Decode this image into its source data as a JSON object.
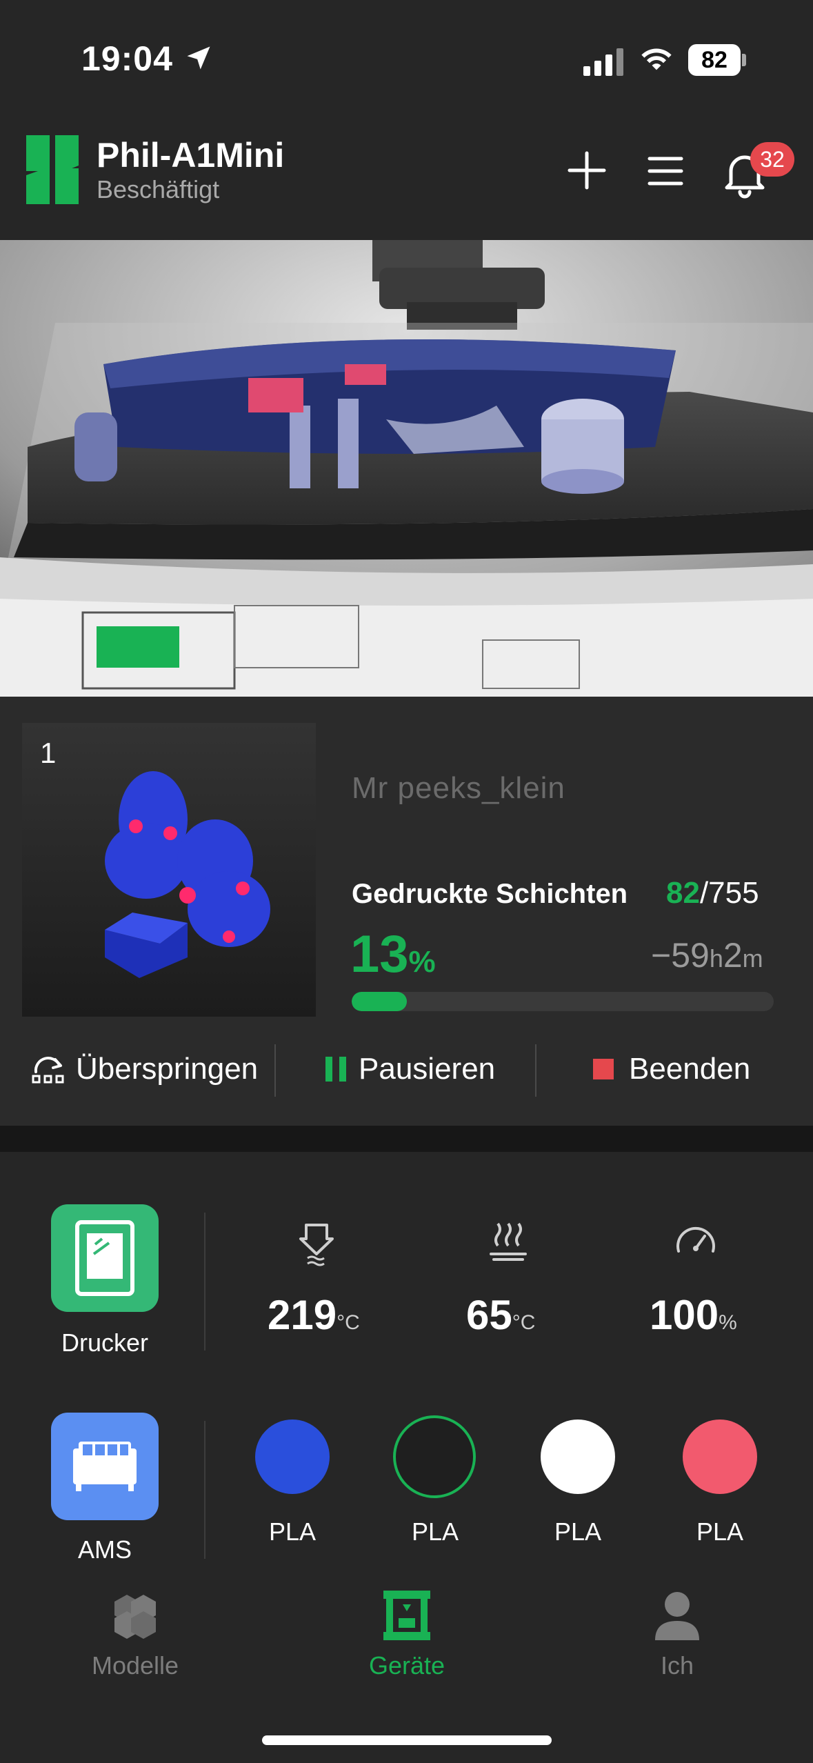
{
  "status_bar": {
    "time": "19:04",
    "battery": "82"
  },
  "header": {
    "title": "Phil-A1Mini",
    "subtitle": "Beschäftigt",
    "notifications": "32"
  },
  "job": {
    "plate": "1",
    "model_name": "Mr peeks_klein",
    "layers_label": "Gedruckte Schichten",
    "layers_current": "82",
    "layers_total": "/755",
    "progress_value": "13",
    "progress_unit": "%",
    "progress_fraction": 0.13,
    "remaining_prefix": "−59",
    "remaining_h": "h",
    "remaining_min": "2",
    "remaining_m": "m"
  },
  "controls": {
    "skip": "Überspringen",
    "pause": "Pausieren",
    "stop": "Beenden"
  },
  "printer": {
    "label": "Drucker",
    "nozzle_temp": "219",
    "nozzle_unit": "°C",
    "bed_temp": "65",
    "bed_unit": "°C",
    "speed": "100",
    "speed_unit": "%"
  },
  "ams": {
    "label": "AMS",
    "spools": [
      {
        "material": "PLA",
        "color": "#2a4fdc"
      },
      {
        "material": "PLA",
        "color": "#1f1f1f"
      },
      {
        "material": "PLA",
        "color": "#ffffff"
      },
      {
        "material": "PLA",
        "color": "#f25a6e"
      }
    ]
  },
  "tabs": [
    {
      "label": "Modelle"
    },
    {
      "label": "Geräte"
    },
    {
      "label": "Ich"
    }
  ],
  "colors": {
    "accent": "#19b254",
    "stop": "#e5484d"
  }
}
